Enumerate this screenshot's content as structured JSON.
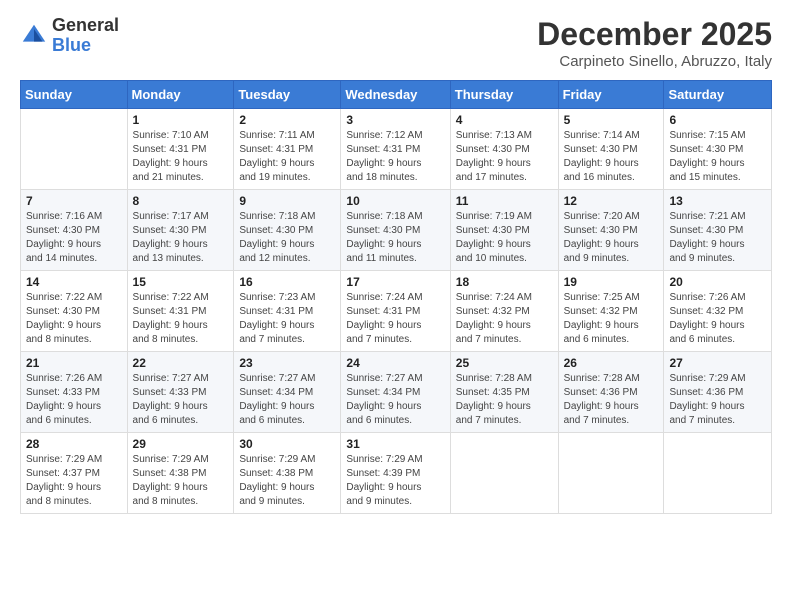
{
  "logo": {
    "general": "General",
    "blue": "Blue"
  },
  "header": {
    "month": "December 2025",
    "location": "Carpineto Sinello, Abruzzo, Italy"
  },
  "weekdays": [
    "Sunday",
    "Monday",
    "Tuesday",
    "Wednesday",
    "Thursday",
    "Friday",
    "Saturday"
  ],
  "weeks": [
    [
      {
        "day": "",
        "info": ""
      },
      {
        "day": "1",
        "info": "Sunrise: 7:10 AM\nSunset: 4:31 PM\nDaylight: 9 hours\nand 21 minutes."
      },
      {
        "day": "2",
        "info": "Sunrise: 7:11 AM\nSunset: 4:31 PM\nDaylight: 9 hours\nand 19 minutes."
      },
      {
        "day": "3",
        "info": "Sunrise: 7:12 AM\nSunset: 4:31 PM\nDaylight: 9 hours\nand 18 minutes."
      },
      {
        "day": "4",
        "info": "Sunrise: 7:13 AM\nSunset: 4:30 PM\nDaylight: 9 hours\nand 17 minutes."
      },
      {
        "day": "5",
        "info": "Sunrise: 7:14 AM\nSunset: 4:30 PM\nDaylight: 9 hours\nand 16 minutes."
      },
      {
        "day": "6",
        "info": "Sunrise: 7:15 AM\nSunset: 4:30 PM\nDaylight: 9 hours\nand 15 minutes."
      }
    ],
    [
      {
        "day": "7",
        "info": "Sunrise: 7:16 AM\nSunset: 4:30 PM\nDaylight: 9 hours\nand 14 minutes."
      },
      {
        "day": "8",
        "info": "Sunrise: 7:17 AM\nSunset: 4:30 PM\nDaylight: 9 hours\nand 13 minutes."
      },
      {
        "day": "9",
        "info": "Sunrise: 7:18 AM\nSunset: 4:30 PM\nDaylight: 9 hours\nand 12 minutes."
      },
      {
        "day": "10",
        "info": "Sunrise: 7:18 AM\nSunset: 4:30 PM\nDaylight: 9 hours\nand 11 minutes."
      },
      {
        "day": "11",
        "info": "Sunrise: 7:19 AM\nSunset: 4:30 PM\nDaylight: 9 hours\nand 10 minutes."
      },
      {
        "day": "12",
        "info": "Sunrise: 7:20 AM\nSunset: 4:30 PM\nDaylight: 9 hours\nand 9 minutes."
      },
      {
        "day": "13",
        "info": "Sunrise: 7:21 AM\nSunset: 4:30 PM\nDaylight: 9 hours\nand 9 minutes."
      }
    ],
    [
      {
        "day": "14",
        "info": "Sunrise: 7:22 AM\nSunset: 4:30 PM\nDaylight: 9 hours\nand 8 minutes."
      },
      {
        "day": "15",
        "info": "Sunrise: 7:22 AM\nSunset: 4:31 PM\nDaylight: 9 hours\nand 8 minutes."
      },
      {
        "day": "16",
        "info": "Sunrise: 7:23 AM\nSunset: 4:31 PM\nDaylight: 9 hours\nand 7 minutes."
      },
      {
        "day": "17",
        "info": "Sunrise: 7:24 AM\nSunset: 4:31 PM\nDaylight: 9 hours\nand 7 minutes."
      },
      {
        "day": "18",
        "info": "Sunrise: 7:24 AM\nSunset: 4:32 PM\nDaylight: 9 hours\nand 7 minutes."
      },
      {
        "day": "19",
        "info": "Sunrise: 7:25 AM\nSunset: 4:32 PM\nDaylight: 9 hours\nand 6 minutes."
      },
      {
        "day": "20",
        "info": "Sunrise: 7:26 AM\nSunset: 4:32 PM\nDaylight: 9 hours\nand 6 minutes."
      }
    ],
    [
      {
        "day": "21",
        "info": "Sunrise: 7:26 AM\nSunset: 4:33 PM\nDaylight: 9 hours\nand 6 minutes."
      },
      {
        "day": "22",
        "info": "Sunrise: 7:27 AM\nSunset: 4:33 PM\nDaylight: 9 hours\nand 6 minutes."
      },
      {
        "day": "23",
        "info": "Sunrise: 7:27 AM\nSunset: 4:34 PM\nDaylight: 9 hours\nand 6 minutes."
      },
      {
        "day": "24",
        "info": "Sunrise: 7:27 AM\nSunset: 4:34 PM\nDaylight: 9 hours\nand 6 minutes."
      },
      {
        "day": "25",
        "info": "Sunrise: 7:28 AM\nSunset: 4:35 PM\nDaylight: 9 hours\nand 7 minutes."
      },
      {
        "day": "26",
        "info": "Sunrise: 7:28 AM\nSunset: 4:36 PM\nDaylight: 9 hours\nand 7 minutes."
      },
      {
        "day": "27",
        "info": "Sunrise: 7:29 AM\nSunset: 4:36 PM\nDaylight: 9 hours\nand 7 minutes."
      }
    ],
    [
      {
        "day": "28",
        "info": "Sunrise: 7:29 AM\nSunset: 4:37 PM\nDaylight: 9 hours\nand 8 minutes."
      },
      {
        "day": "29",
        "info": "Sunrise: 7:29 AM\nSunset: 4:38 PM\nDaylight: 9 hours\nand 8 minutes."
      },
      {
        "day": "30",
        "info": "Sunrise: 7:29 AM\nSunset: 4:38 PM\nDaylight: 9 hours\nand 9 minutes."
      },
      {
        "day": "31",
        "info": "Sunrise: 7:29 AM\nSunset: 4:39 PM\nDaylight: 9 hours\nand 9 minutes."
      },
      {
        "day": "",
        "info": ""
      },
      {
        "day": "",
        "info": ""
      },
      {
        "day": "",
        "info": ""
      }
    ]
  ]
}
